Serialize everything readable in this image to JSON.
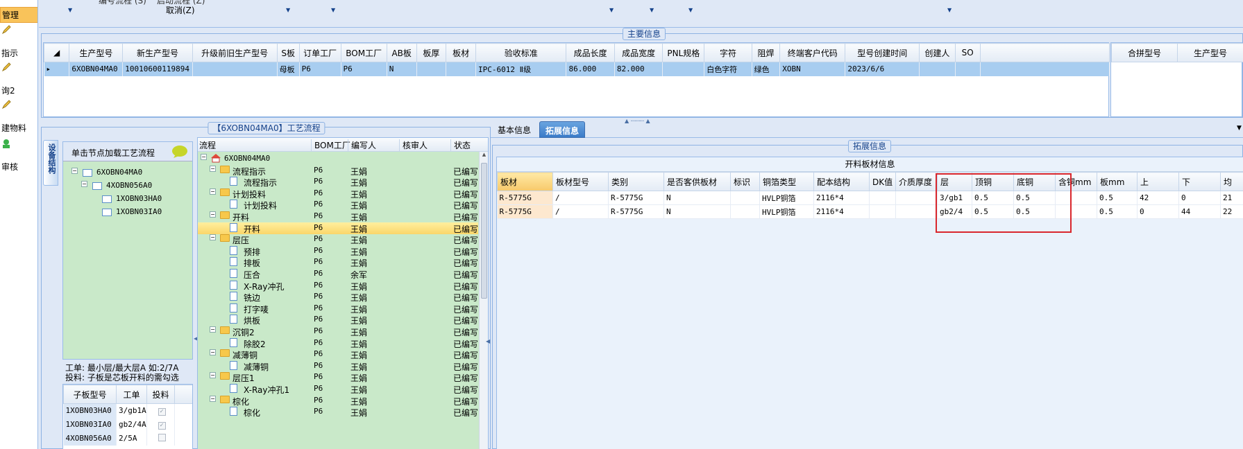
{
  "leftnav": {
    "items": [
      "管理",
      "指示",
      "询2",
      "建物料",
      "审核"
    ]
  },
  "toolbar": {
    "item1": "编号流程 (S)",
    "item2": "启动流程 (Z)",
    "item3": "取消(Z)"
  },
  "main_group": {
    "title": "主要信息"
  },
  "main_grid": {
    "headers": [
      "生产型号",
      "新生产型号",
      "升级前旧生产型号",
      "S板",
      "订单工厂",
      "BOM工厂",
      "AB板",
      "板厚",
      "板材",
      "验收标准",
      "成品长度",
      "成品宽度",
      "PNL规格",
      "字符",
      "阻焊",
      "终端客户代码",
      "型号创建时间",
      "创建人",
      "SO"
    ],
    "row": [
      "6XOBN04MA0",
      "10010600119894",
      "",
      "母板",
      "P6",
      "P6",
      "N",
      "",
      "",
      "IPC-6012 Ⅱ级",
      "86.000",
      "82.000",
      "",
      "白色字符",
      "绿色",
      "XOBN",
      "2023/6/6",
      "",
      ""
    ]
  },
  "right_grid": {
    "headers": [
      "合拼型号",
      "生产型号"
    ]
  },
  "process_group": {
    "title": "【6XOBN04MA0】工艺流程"
  },
  "vertical_tab": "设备结构",
  "tree_panel": {
    "hint": "单击节点加载工艺流程",
    "nodes": [
      "6XOBN04MA0",
      "4XOBN056A0",
      "1XOBN03HA0",
      "1XOBN03IA0"
    ]
  },
  "notes": {
    "line1": "工单: 最小层/最大层A 如:2/7A",
    "line2": "投料: 子板是芯板开料的需勾选"
  },
  "sub_grid": {
    "headers": [
      "子板型号",
      "工单",
      "投料"
    ],
    "rows": [
      [
        "1XOBN03HA0",
        "3/gb1A",
        "✓"
      ],
      [
        "1XOBN03IA0",
        "gb2/4A",
        "✓"
      ],
      [
        "4XOBN056A0",
        "2/5A",
        ""
      ]
    ]
  },
  "process_grid": {
    "headers": [
      "流程",
      "BOM工厂",
      "编写人",
      "核审人",
      "状态"
    ],
    "root": "6XOBN04MA0",
    "rows": [
      {
        "name": "流程指示",
        "level": 1,
        "folder": true,
        "factory": "P6",
        "writer": "王娟",
        "status": "已编写"
      },
      {
        "name": "流程指示",
        "level": 2,
        "folder": false,
        "factory": "P6",
        "writer": "王娟",
        "status": "已编写"
      },
      {
        "name": "计划投料",
        "level": 1,
        "folder": true,
        "factory": "P6",
        "writer": "王娟",
        "status": "已编写"
      },
      {
        "name": "计划投料",
        "level": 2,
        "folder": false,
        "factory": "P6",
        "writer": "王娟",
        "status": "已编写"
      },
      {
        "name": "开料",
        "level": 1,
        "folder": true,
        "factory": "P6",
        "writer": "王娟",
        "status": "已编写"
      },
      {
        "name": "开料",
        "level": 2,
        "folder": false,
        "factory": "P6",
        "writer": "王娟",
        "status": "已编写",
        "selected": true
      },
      {
        "name": "层压",
        "level": 1,
        "folder": true,
        "factory": "P6",
        "writer": "王娟",
        "status": "已编写"
      },
      {
        "name": "预排",
        "level": 2,
        "folder": false,
        "factory": "P6",
        "writer": "王娟",
        "status": "已编写"
      },
      {
        "name": "排板",
        "level": 2,
        "folder": false,
        "factory": "P6",
        "writer": "王娟",
        "status": "已编写"
      },
      {
        "name": "压合",
        "level": 2,
        "folder": false,
        "factory": "P6",
        "writer": "余军",
        "status": "已编写"
      },
      {
        "name": "X-Ray冲孔",
        "level": 2,
        "folder": false,
        "factory": "P6",
        "writer": "王娟",
        "status": "已编写"
      },
      {
        "name": "铣边",
        "level": 2,
        "folder": false,
        "factory": "P6",
        "writer": "王娟",
        "status": "已编写"
      },
      {
        "name": "打字唛",
        "level": 2,
        "folder": false,
        "factory": "P6",
        "writer": "王娟",
        "status": "已编写"
      },
      {
        "name": "烘板",
        "level": 2,
        "folder": false,
        "factory": "P6",
        "writer": "王娟",
        "status": "已编写"
      },
      {
        "name": "沉铜2",
        "level": 1,
        "folder": true,
        "factory": "P6",
        "writer": "王娟",
        "status": "已编写"
      },
      {
        "name": "除胶2",
        "level": 2,
        "folder": false,
        "factory": "P6",
        "writer": "王娟",
        "status": "已编写"
      },
      {
        "name": "减薄铜",
        "level": 1,
        "folder": true,
        "factory": "P6",
        "writer": "王娟",
        "status": "已编写"
      },
      {
        "name": "减薄铜",
        "level": 2,
        "folder": false,
        "factory": "P6",
        "writer": "王娟",
        "status": "已编写"
      },
      {
        "name": "层压1",
        "level": 1,
        "folder": true,
        "factory": "P6",
        "writer": "王娟",
        "status": "已编写"
      },
      {
        "name": "X-Ray冲孔1",
        "level": 2,
        "folder": false,
        "factory": "P6",
        "writer": "王娟",
        "status": "已编写"
      },
      {
        "name": "棕化",
        "level": 1,
        "folder": true,
        "factory": "P6",
        "writer": "王娟",
        "status": "已编写"
      },
      {
        "name": "棕化",
        "level": 2,
        "folder": false,
        "factory": "P6",
        "writer": "王娟",
        "status": "已编写"
      }
    ]
  },
  "tabs": [
    "基本信息",
    "拓展信息"
  ],
  "ext_group": {
    "title": "拓展信息"
  },
  "ext_grid": {
    "caption": "开料板材信息",
    "headers": [
      "板材",
      "板材型号",
      "类别",
      "是否客供板材",
      "标识",
      "铜箔类型",
      "配本结构",
      "DK值",
      "介质厚度",
      "层",
      "顶铜",
      "底铜",
      "含铜mm",
      "板mm",
      "上",
      "下",
      "均"
    ],
    "rows": [
      [
        "R-5775G",
        "/",
        "R-5775G",
        "N",
        "",
        "HVLP铜箔",
        "2116*4",
        "",
        "",
        "3/gb1",
        "0.5",
        "0.5",
        "",
        "0.5",
        "42",
        "0",
        "21"
      ],
      [
        "R-5775G",
        "/",
        "R-5775G",
        "N",
        "",
        "HVLP铜箔",
        "2116*4",
        "",
        "",
        "gb2/4",
        "0.5",
        "0.5",
        "",
        "0.5",
        "0",
        "44",
        "22"
      ]
    ]
  },
  "colors": {
    "panel_bg": "#dfe8f6",
    "border": "#8db2e3",
    "selected_row": "#a8cdf0",
    "tree_bg": "#c9e9c9",
    "highlight": "#fad66a",
    "annotation": "#d9262c"
  }
}
